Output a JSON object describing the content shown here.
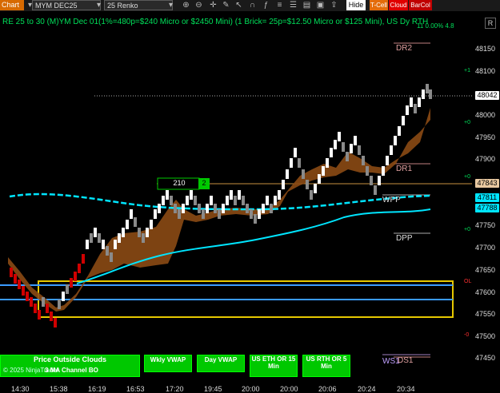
{
  "toolbar": {
    "chart_label": "Chart",
    "instrument": "MYM DEC25",
    "bar_type": "25 Renko",
    "hide_label": "Hide",
    "tcell_label": "T-Cell",
    "cloud_label": "Cloud",
    "barcol_label": "BarCol"
  },
  "headline": "RE 25 to 30 (M)YM Dec 01(1%=480p=$240 Micro or $2450 Mini) (1 Brick= 25p=$12.50 Micro or $125 Mini), US Dy RTH",
  "headline_right": "11 0.00% 4.8",
  "corner_label": "R",
  "price_axis": {
    "ticks": [
      "48150",
      "48100",
      "48050",
      "48000",
      "47950",
      "47900",
      "47850",
      "47800",
      "47750",
      "47700",
      "47650",
      "47600",
      "47550",
      "47500",
      "47450"
    ],
    "current_price": "48042",
    "tag_orange": "47843",
    "tag_cyan_1": "47811",
    "tag_cyan_2": "47788",
    "side_marks": [
      "+1",
      "+0",
      "+0",
      "+0",
      "OL",
      "-0",
      "-0"
    ]
  },
  "time_axis": [
    "14:30",
    "15:38",
    "16:19",
    "16:53",
    "17:20",
    "19:45",
    "20:00",
    "20:00",
    "20:06",
    "20:24",
    "20:34"
  ],
  "levels": {
    "dr2": "DR2",
    "dr1": "DR1",
    "wpp": "WPP",
    "dpp": "DPP",
    "ws1": "WS1",
    "ds1": "DS1"
  },
  "counter": {
    "value": "210",
    "badge": "2"
  },
  "bottom_buttons": {
    "price_outside": "Price Outside Clouds",
    "copyright": "© 2025 NinjaTrader",
    "ma_channel": "3 MA Channel BO",
    "wkly_vwap": "Wkly VWAP",
    "day_vwap": "Day VWAP",
    "us_eth": "US ETH OR 15 Min",
    "us_rth": "US RTH OR 5 Min"
  },
  "colors": {
    "up_brick": "#ffffff",
    "down_brick": "#d00000",
    "gray_brick": "#8a8a8a",
    "cloud": "#8b4a14",
    "vwap_cyan": "#00e5ff",
    "blue_line": "#3a9bff",
    "or_box": "#e6c800",
    "accent_green": "#00c800"
  }
}
